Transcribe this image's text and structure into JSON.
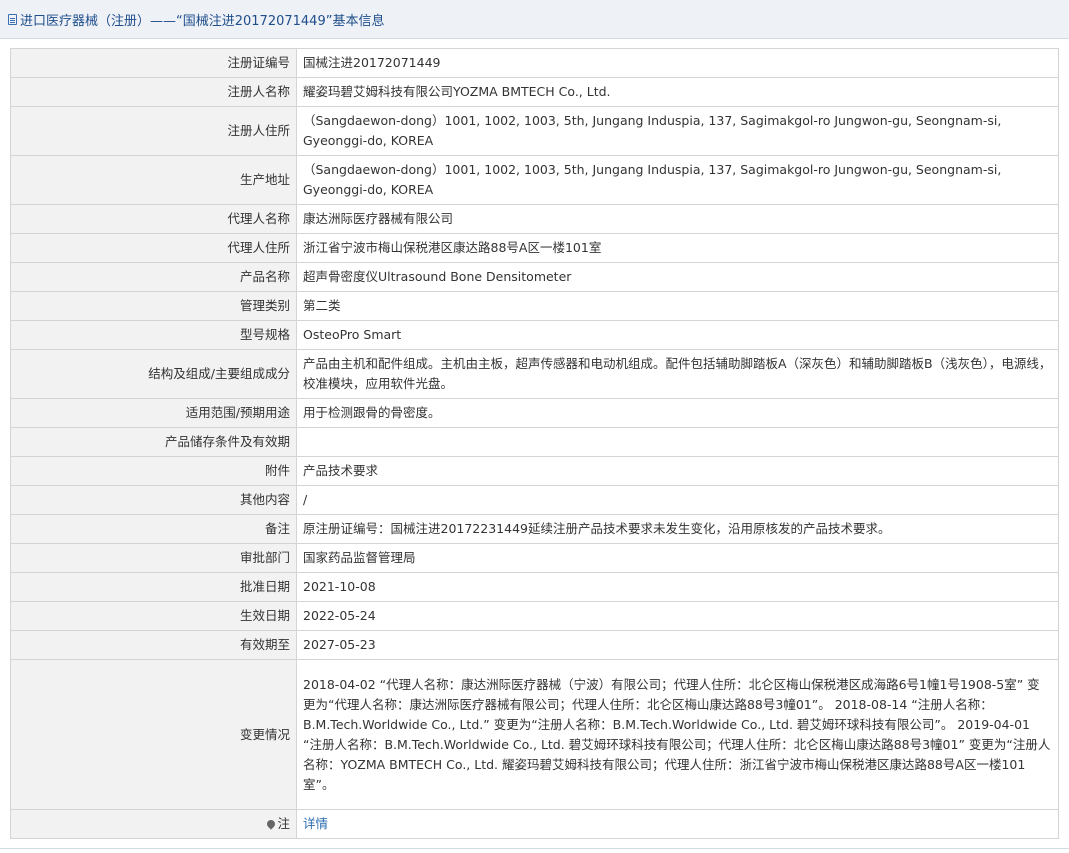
{
  "header": {
    "title": "进口医疗器械（注册）——“国械注进20172071449”基本信息"
  },
  "rows": [
    {
      "label": "注册证编号",
      "value": "国械注进20172071449"
    },
    {
      "label": "注册人名称",
      "value": "耀姿玛碧艾姆科技有限公司YOZMA BMTECH Co., Ltd."
    },
    {
      "label": "注册人住所",
      "value": "（Sangdaewon-dong）1001, 1002, 1003, 5th, Jungang Induspia, 137, Sagimakgol-ro Jungwon-gu, Seongnam-si, Gyeonggi-do, KOREA"
    },
    {
      "label": "生产地址",
      "value": "（Sangdaewon-dong）1001, 1002, 1003, 5th, Jungang Induspia, 137, Sagimakgol-ro Jungwon-gu, Seongnam-si, Gyeonggi-do, KOREA"
    },
    {
      "label": "代理人名称",
      "value": "康达洲际医疗器械有限公司"
    },
    {
      "label": "代理人住所",
      "value": "浙江省宁波市梅山保税港区康达路88号A区一楼101室"
    },
    {
      "label": "产品名称",
      "value": "超声骨密度仪Ultrasound Bone Densitometer"
    },
    {
      "label": "管理类别",
      "value": "第二类"
    },
    {
      "label": "型号规格",
      "value": "OsteoPro Smart"
    },
    {
      "label": "结构及组成/主要组成成分",
      "value": "产品由主机和配件组成。主机由主板，超声传感器和电动机组成。配件包括辅助脚踏板A（深灰色）和辅助脚踏板B（浅灰色），电源线，校准模块，应用软件光盘。"
    },
    {
      "label": "适用范围/预期用途",
      "value": "用于检测跟骨的骨密度。"
    },
    {
      "label": "产品储存条件及有效期",
      "value": ""
    },
    {
      "label": "附件",
      "value": "产品技术要求"
    },
    {
      "label": "其他内容",
      "value": "/"
    },
    {
      "label": "备注",
      "value": "原注册证编号：国械注进20172231449延续注册产品技术要求未发生变化，沿用原核发的产品技术要求。"
    },
    {
      "label": "审批部门",
      "value": "国家药品监督管理局"
    },
    {
      "label": "批准日期",
      "value": "2021-10-08"
    },
    {
      "label": "生效日期",
      "value": "2022-05-24"
    },
    {
      "label": "有效期至",
      "value": "2027-05-23"
    },
    {
      "label": "变更情况",
      "value": "2018-04-02 “代理人名称：康达洲际医疗器械（宁波）有限公司；代理人住所：北仑区梅山保税港区成海路6号1幢1号1908-5室” 变更为“代理人名称：康达洲际医疗器械有限公司；代理人住所：北仑区梅山康达路88号3幢01”。 2018-08-14 “注册人名称：B.M.Tech.Worldwide Co., Ltd.” 变更为“注册人名称：B.M.Tech.Worldwide Co., Ltd. 碧艾姆环球科技有限公司”。 2019-04-01 “注册人名称：B.M.Tech.Worldwide Co., Ltd. 碧艾姆环球科技有限公司；代理人住所：北仑区梅山康达路88号3幢01” 变更为“注册人名称：YOZMA BMTECH Co., Ltd. 耀姿玛碧艾姆科技有限公司；代理人住所：浙江省宁波市梅山保税港区康达路88号A区一楼101室”。"
    }
  ],
  "note_row": {
    "label": "注",
    "link": "详情"
  },
  "icons": {
    "title": "document-icon",
    "note": "pin-icon"
  },
  "colors": {
    "title_text": "#1f4e8c",
    "link": "#2b6cb0",
    "label_bg": "#f2f2f2",
    "border": "#d4d4d4"
  }
}
